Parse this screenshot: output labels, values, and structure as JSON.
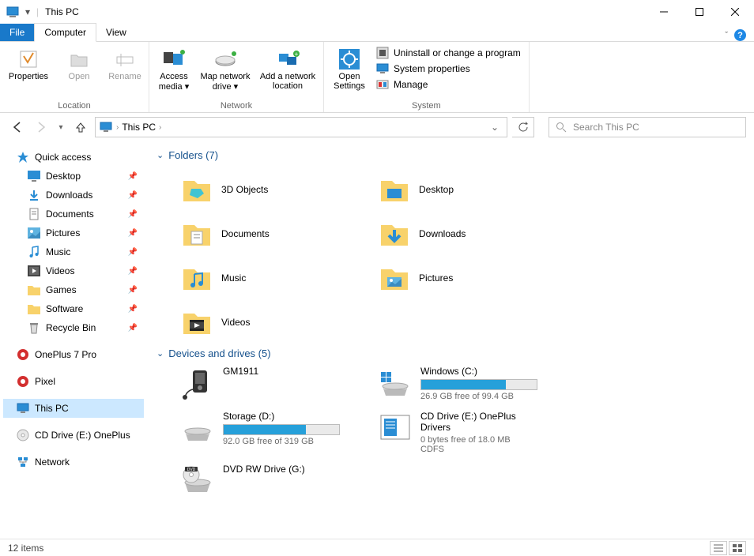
{
  "window": {
    "title": "This PC"
  },
  "menutabs": {
    "file": "File",
    "computer": "Computer",
    "view": "View"
  },
  "ribbon": {
    "properties": "Properties",
    "open": "Open",
    "rename": "Rename",
    "access_media": "Access media",
    "map_drive": "Map network drive",
    "add_location": "Add a network location",
    "open_settings": "Open Settings",
    "uninstall": "Uninstall or change a program",
    "sysprops": "System properties",
    "manage": "Manage",
    "group_location": "Location",
    "group_network": "Network",
    "group_system": "System"
  },
  "address": {
    "crumb": "This PC"
  },
  "search": {
    "placeholder": "Search This PC"
  },
  "sidebar": {
    "quick_access": "Quick access",
    "items": [
      {
        "label": "Desktop"
      },
      {
        "label": "Downloads"
      },
      {
        "label": "Documents"
      },
      {
        "label": "Pictures"
      },
      {
        "label": "Music"
      },
      {
        "label": "Videos"
      },
      {
        "label": "Games"
      },
      {
        "label": "Software"
      },
      {
        "label": "Recycle Bin"
      }
    ],
    "oneplus": "OnePlus 7 Pro",
    "pixel": "Pixel",
    "this_pc": "This PC",
    "cd_drive": "CD Drive (E:) OnePlus",
    "network": "Network"
  },
  "sections": {
    "folders": "Folders (7)",
    "drives": "Devices and drives (5)"
  },
  "folders": [
    {
      "label": "3D Objects"
    },
    {
      "label": "Desktop"
    },
    {
      "label": "Documents"
    },
    {
      "label": "Downloads"
    },
    {
      "label": "Music"
    },
    {
      "label": "Pictures"
    },
    {
      "label": "Videos"
    }
  ],
  "drives": [
    {
      "name": "GM1911",
      "type": "device"
    },
    {
      "name": "Windows (C:)",
      "type": "hdd",
      "free": "26.9 GB free of 99.4 GB",
      "pct": 73
    },
    {
      "name": "Storage (D:)",
      "type": "hdd",
      "free": "92.0 GB free of 319 GB",
      "pct": 71
    },
    {
      "name": "CD Drive (E:) OnePlus Drivers",
      "type": "cd",
      "free": "0 bytes free of 18.0 MB",
      "fs": "CDFS"
    },
    {
      "name": "DVD RW Drive (G:)",
      "type": "dvd"
    }
  ],
  "status": {
    "count": "12 items"
  }
}
